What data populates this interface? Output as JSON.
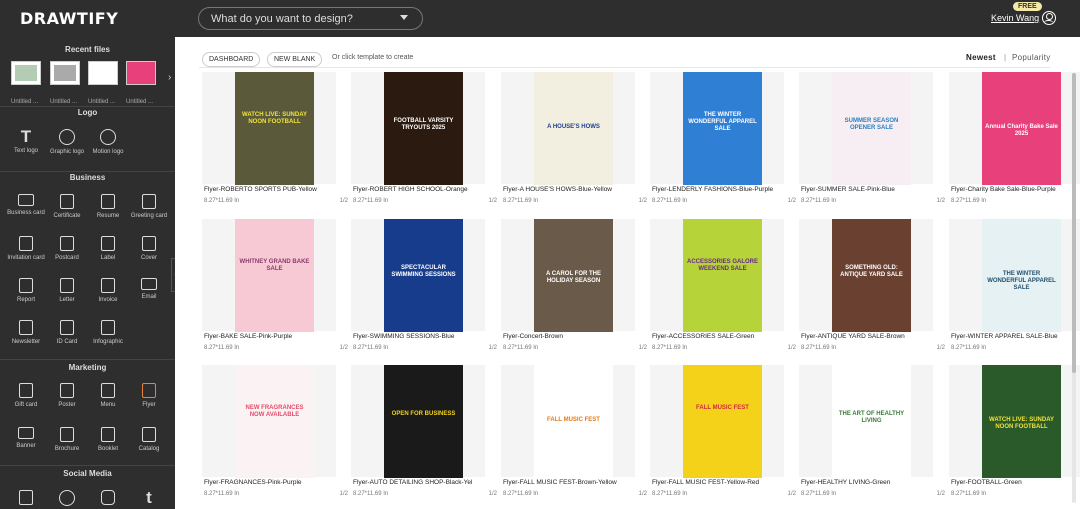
{
  "header": {
    "logo": "DRAWTIFY",
    "search_placeholder": "What do you want to design?",
    "badge": "FREE",
    "username": "Kevin Wang"
  },
  "sidebar": {
    "recent_title": "Recent files",
    "recent_files": [
      "Untitled ...",
      "Untitled ...",
      "Untitled ...",
      "Untitled ..."
    ],
    "logo_title": "Logo",
    "logo_items": [
      "Text logo",
      "Graphic logo",
      "Motion logo"
    ],
    "business_title": "Business",
    "business_items": [
      "Business card",
      "Certificate",
      "Resume",
      "Greeting card",
      "Invitation card",
      "Postcard",
      "Label",
      "Cover",
      "Report",
      "Letter",
      "Invoice",
      "Email",
      "Newsletter",
      "ID Card",
      "Infographic"
    ],
    "marketing_title": "Marketing",
    "marketing_items": [
      "Gift card",
      "Poster",
      "Menu",
      "Flyer",
      "Banner",
      "Brochure",
      "Booklet",
      "Catalog"
    ],
    "social_title": "Social Media",
    "collapse_glyph": "‹"
  },
  "toolbar": {
    "dashboard": "DASHBOARD",
    "new_blank": "NEW BLANK",
    "hint": "Or click template to create",
    "sort_newest": "Newest",
    "sort_sep": "|",
    "sort_popularity": "Popularity"
  },
  "templates": [
    {
      "name": "Flyer-ROBERTO SPORTS PUB-Yellow",
      "size": "8.27*11.69 In",
      "pages": "1/2",
      "bg": "#5a5a3a",
      "fg": "#f2e23a",
      "text": "WATCH LIVE: SUNDAY NOON FOOTBALL"
    },
    {
      "name": "Flyer-ROBERT HIGH SCHOOL-Orange",
      "size": "8.27*11.69 In",
      "pages": "1/2",
      "bg": "#2a1a10",
      "fg": "#ffffff",
      "text": "FOOTBALL VARSITY TRYOUTS 2025"
    },
    {
      "name": "Flyer-A HOUSE'S HOWS-Blue-Yellow",
      "size": "8.27*11.69 In",
      "pages": "1/2",
      "bg": "#f3efe0",
      "fg": "#1f3f8f",
      "text": "A HOUSE'S HOWS"
    },
    {
      "name": "Flyer-LENDERLY FASHIONS-Blue-Purple",
      "size": "8.27*11.69 In",
      "pages": "1/2",
      "bg": "#2f7fd4",
      "fg": "#ffffff",
      "text": "THE WINTER WONDERFUL APPAREL SALE"
    },
    {
      "name": "Flyer-SUMMER SALE-Pink-Blue",
      "size": "8.27*11.69 In",
      "pages": "1/2",
      "bg": "#f6eef2",
      "fg": "#2b7fbf",
      "text": "SUMMER SEASON OPENER SALE"
    },
    {
      "name": "Flyer-Charity Bake Sale-Blue-Purple",
      "size": "8.27*11.69 In",
      "pages": "1/2",
      "bg": "#e8407a",
      "fg": "#ffffff",
      "text": "Annual Charity Bake Sale 2025"
    },
    {
      "name": "Flyer-BAKE SALE-Pink-Purple",
      "size": "8.27*11.69 In",
      "pages": "1/2",
      "bg": "#f7c9d4",
      "fg": "#8a3b6a",
      "text": "WHITNEY GRAND BAKE SALE"
    },
    {
      "name": "Flyer-SWIMMING SESSIONS-Blue",
      "size": "8.27*11.69 In",
      "pages": "1/2",
      "bg": "#173c8c",
      "fg": "#ffffff",
      "text": "SPECTACULAR SWIMMING SESSIONS"
    },
    {
      "name": "Flyer-Concert-Brown",
      "size": "8.27*11.69 In",
      "pages": "1/2",
      "bg": "#6a5a4a",
      "fg": "#ffffff",
      "text": "A CAROL FOR THE HOLIDAY SEASON"
    },
    {
      "name": "Flyer-ACCESSORIES SALE-Green",
      "size": "8.27*11.69 In",
      "pages": "1/2",
      "bg": "#b6d43a",
      "fg": "#6a2a8a",
      "text": "ACCESSORIES GALORE WEEKEND SALE"
    },
    {
      "name": "Flyer-ANTIQUE YARD SALE-Brown",
      "size": "8.27*11.69 In",
      "pages": "1/2",
      "bg": "#6a4030",
      "fg": "#ffffff",
      "text": "SOMETHING OLD: ANTIQUE YARD SALE"
    },
    {
      "name": "Flyer-WINTER APPAREL SALE-Blue",
      "size": "8.27*11.69 In",
      "pages": "1/2",
      "bg": "#e6f1f4",
      "fg": "#1f4f6f",
      "text": "THE WINTER WONDERFUL APPAREL SALE"
    },
    {
      "name": "Flyer-FRAGNANCES-Pink-Purple",
      "size": "8.27*11.69 In",
      "pages": "1/2",
      "bg": "#fbf3f3",
      "fg": "#e64a6a",
      "text": "NEW FRAGRANCES NOW AVAILABLE"
    },
    {
      "name": "Flyer-AUTO DETAILING SHOP-Black-Yel",
      "size": "8.27*11.69 In",
      "pages": "1/2",
      "bg": "#1a1a1a",
      "fg": "#f2d21a",
      "text": "OPEN FOR BUSINESS"
    },
    {
      "name": "Flyer-FALL MUSIC FEST-Brown-Yellow",
      "size": "8.27*11.69 In",
      "pages": "1/2",
      "bg": "#ffffff",
      "fg": "#e67a1a",
      "text": "FALL MUSIC FEST"
    },
    {
      "name": "Flyer-FALL MUSIC FEST-Yellow-Red",
      "size": "8.27*11.69 In",
      "pages": "1/2",
      "bg": "#f5d21a",
      "fg": "#d4283a",
      "text": "FALL MUSIC FEST"
    },
    {
      "name": "Flyer-HEALTHY LIVING-Green",
      "size": "8.27*11.69 In",
      "pages": "1/2",
      "bg": "#ffffff",
      "fg": "#3a7a3a",
      "text": "THE ART OF HEALTHY LIVING"
    },
    {
      "name": "Flyer-FOOTBALL-Green",
      "size": "8.27*11.69 In",
      "pages": "1/2",
      "bg": "#2a5a2a",
      "fg": "#f2e23a",
      "text": "WATCH LIVE: SUNDAY NOON FOOTBALL"
    }
  ]
}
